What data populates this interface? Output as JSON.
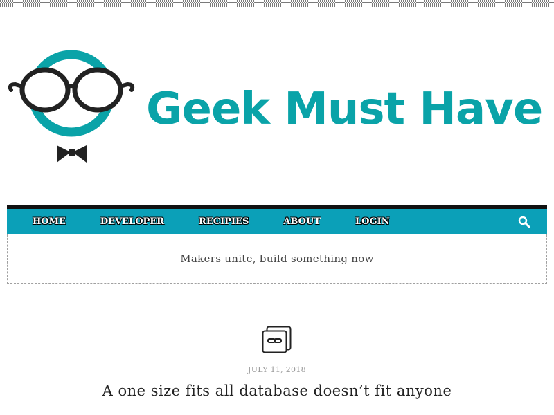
{
  "site": {
    "logo_text": "Geek Must Have",
    "logo_icon": "geek-glasses-mascot-icon",
    "tagline": "Makers unite, build something now"
  },
  "colors": {
    "brand_teal": "#0aa3a8",
    "nav_background": "#0ba0b8",
    "nav_top_border": "#111111",
    "glasses": "#222222"
  },
  "nav": {
    "items": [
      {
        "label": "HOME"
      },
      {
        "label": "DEVELOPER"
      },
      {
        "label": "RECIPIES"
      },
      {
        "label": "ABOUT"
      },
      {
        "label": "LOGIN"
      }
    ],
    "search_icon": "search-icon"
  },
  "post": {
    "format_icon": "gallery-format-icon",
    "date": "JULY 11, 2018",
    "title": "A one size fits all database doesn’t fit anyone"
  }
}
